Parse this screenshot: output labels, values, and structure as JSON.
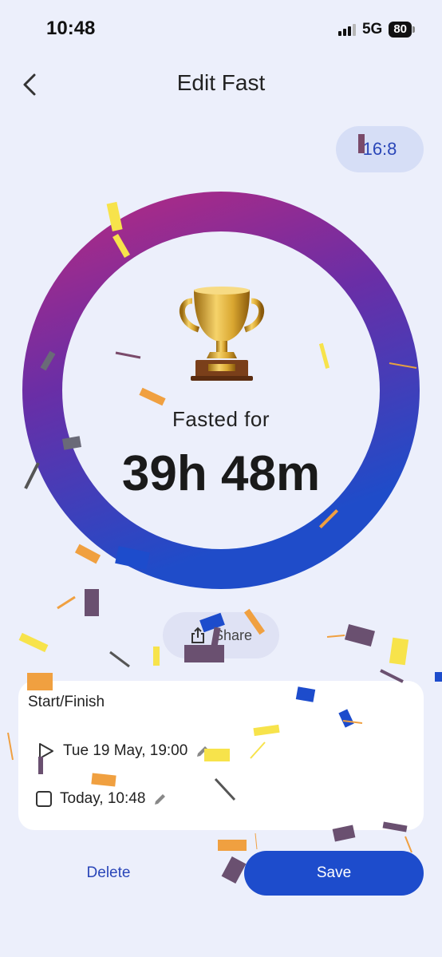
{
  "status_bar": {
    "time": "10:48",
    "network": "5G",
    "battery": "80"
  },
  "header": {
    "title": "Edit Fast",
    "back_icon": "chevron-left-icon"
  },
  "plan": {
    "label": "16:8"
  },
  "progress": {
    "fraction": 1.0,
    "gradient_start": "#b02a84",
    "gradient_end": "#1f4cc9"
  },
  "result": {
    "label": "Fasted for",
    "value": "39h 48m",
    "icon": "trophy-icon"
  },
  "share": {
    "label": "Share",
    "icon": "share-icon"
  },
  "times_card": {
    "title": "Start/Finish",
    "start": {
      "value": "Tue 19 May, 19:00",
      "icon": "play-outline-icon"
    },
    "finish": {
      "value": "Today, 10:48",
      "icon": "checkbox-icon"
    },
    "edit_icon": "pencil-icon"
  },
  "actions": {
    "delete_label": "Delete",
    "save_label": "Save",
    "accent": "#1d4ccc"
  }
}
